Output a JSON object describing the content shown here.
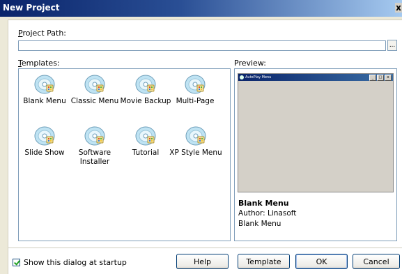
{
  "window": {
    "title": "New Project",
    "close_label": "x"
  },
  "project_path": {
    "label": "Project Path:",
    "label_underline": "P",
    "label_rest": "roject Path:",
    "value": "",
    "browse_label": "..."
  },
  "templates": {
    "label_underline": "T",
    "label_rest": "emplates:",
    "items": [
      {
        "label": "Blank Menu"
      },
      {
        "label": "Classic Menu"
      },
      {
        "label": "Movie Backup"
      },
      {
        "label": "Multi-Page"
      },
      {
        "label": "Slide Show"
      },
      {
        "label": "Software Installer"
      },
      {
        "label": "Tutorial"
      },
      {
        "label": "XP Style Menu"
      }
    ]
  },
  "preview": {
    "label": "Preview:",
    "window_title": "AutoPlay Menu",
    "window_buttons": [
      "_",
      "□",
      "x"
    ],
    "name": "Blank Menu",
    "author": "Author:  Linasoft",
    "description": "Blank Menu"
  },
  "footer": {
    "show_dialog_label": "Show this dialog at startup",
    "show_dialog_checked": true,
    "help_label": "Help",
    "template_label": "Template",
    "ok_label": "OK",
    "cancel_label": "Cancel"
  },
  "icons": {
    "template_icon": "cd-disc-icon",
    "accent": "#0A246A"
  }
}
